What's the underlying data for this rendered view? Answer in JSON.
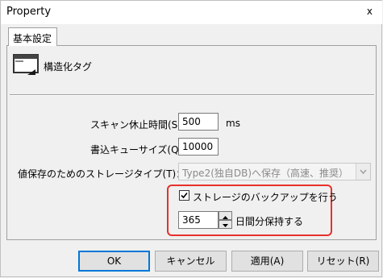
{
  "window": {
    "title": "Property",
    "close_label": "x"
  },
  "tab": {
    "label": "基本設定"
  },
  "section": {
    "title": "構造化タグ"
  },
  "fields": {
    "scan_pause": {
      "label": "スキャン休止時間(S)：",
      "value": "500",
      "unit": "ms"
    },
    "write_queue": {
      "label": "書込キューサイズ(Q)：",
      "value": "10000"
    },
    "storage_type": {
      "label": "値保存のためのストレージタイプ(T)：",
      "value": "Type2(独自DB)へ保存（高速、推奨）"
    }
  },
  "backup": {
    "checkbox_label": "ストレージのバックアップを行う",
    "checked": true,
    "days_value": "365",
    "days_label": "日間分保持する"
  },
  "buttons": {
    "ok": "OK",
    "cancel": "キャンセル",
    "apply": "適用(A)",
    "reset": "リセット(R)"
  },
  "colors": {
    "highlight": "#e8302c",
    "default_button_border": "#0078d7"
  }
}
